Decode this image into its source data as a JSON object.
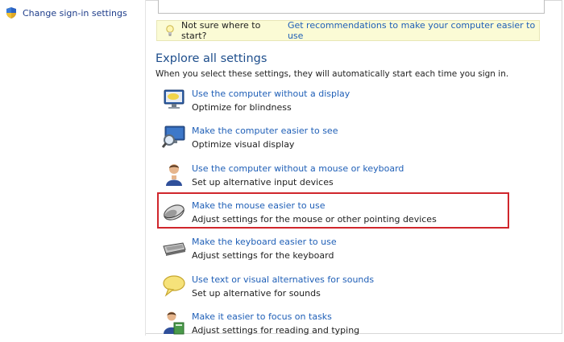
{
  "left_pane": {
    "change_signin_label": "Change sign-in settings"
  },
  "tip": {
    "question": "Not sure where to start?",
    "link": "Get recommendations to make your computer easier to use"
  },
  "section": {
    "title": "Explore all settings",
    "description": "When you select these settings, they will automatically start each time you sign in."
  },
  "items": [
    {
      "title": "Use the computer without a display",
      "subtitle": "Optimize for blindness",
      "icon": "monitor-icon"
    },
    {
      "title": "Make the computer easier to see",
      "subtitle": "Optimize visual display",
      "icon": "magnifier-monitor-icon"
    },
    {
      "title": "Use the computer without a mouse or keyboard",
      "subtitle": "Set up alternative input devices",
      "icon": "person-icon"
    },
    {
      "title": "Make the mouse easier to use",
      "subtitle": "Adjust settings for the mouse or other pointing devices",
      "icon": "mouse-icon"
    },
    {
      "title": "Make the keyboard easier to use",
      "subtitle": "Adjust settings for the keyboard",
      "icon": "keyboard-icon"
    },
    {
      "title": "Use text or visual alternatives for sounds",
      "subtitle": "Set up alternative for sounds",
      "icon": "speech-bubble-icon"
    },
    {
      "title": "Make it easier to focus on tasks",
      "subtitle": "Adjust settings for reading and typing",
      "icon": "person-book-icon"
    }
  ],
  "colors": {
    "link": "#1f5fb7",
    "heading": "#1e4e8c",
    "tip_background": "#fbfbd5",
    "highlight": "#d0262c"
  }
}
